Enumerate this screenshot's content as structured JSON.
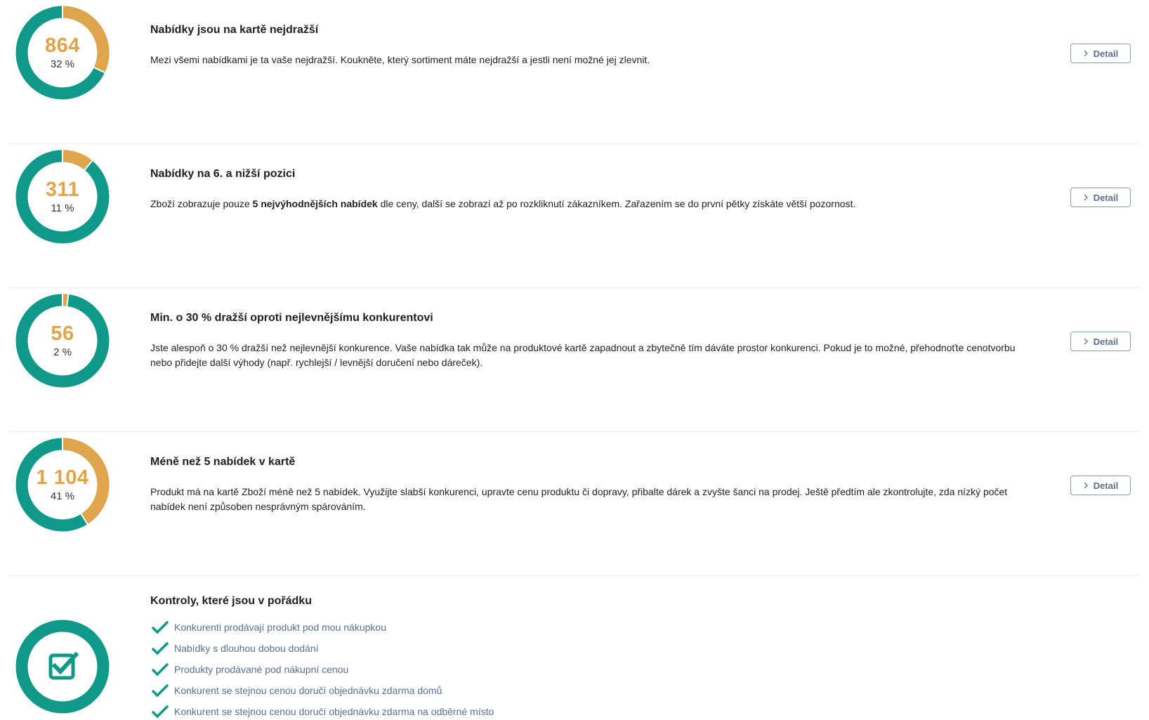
{
  "colors": {
    "teal": "#0f9988",
    "orange": "#e0a44a",
    "detail_border": "#8a9bb3",
    "detail_text": "#5b6f8f",
    "check_text": "#5b6f8f"
  },
  "rows": [
    {
      "value": "864",
      "percent": "32 %",
      "fraction": 0.32,
      "title": "Nabídky jsou na kartě nejdražší",
      "desc_before": "Mezi všemi nabídkami je ta vaše nejdražší. Koukněte, který sortiment máte nejdražší a jestli není možné jej zlevnit.",
      "desc_bold": "",
      "desc_after": "",
      "button": "Detail"
    },
    {
      "value": "311",
      "percent": "11 %",
      "fraction": 0.11,
      "title": "Nabídky na 6. a nižší pozici",
      "desc_before": "Zboží zobrazuje pouze ",
      "desc_bold": "5 nejvýhodnějších nabídek",
      "desc_after": " dle ceny, další se zobrazí až po rozkliknutí zákazníkem. Zařazením se do první pětky získáte větší pozornost.",
      "button": "Detail"
    },
    {
      "value": "56",
      "percent": "2 %",
      "fraction": 0.02,
      "title": "Min. o 30 % dražší oproti nejlevnějšímu konkurentovi",
      "desc_before": "Jste alespoň o 30 % dražší než nejlevnější konkurence. Vaše nabídka tak může na produktové kartě zapadnout a zbytečně tím dáváte prostor konkurenci. Pokud je to možné, přehodnoťte cenotvorbu nebo přidejte další výhody (např. rychlejší / levnější doručení nebo dáreček).",
      "desc_bold": "",
      "desc_after": "",
      "button": "Detail"
    },
    {
      "value": "1 104",
      "percent": "41 %",
      "fraction": 0.41,
      "title": "Méně než 5 nabídek v kartě",
      "desc_before": "Produkt má na kartě Zboží méně než 5 nabídek. Využijte slabší konkurenci, upravte cenu produktu či dopravy, přibalte dárek a zvyšte šanci na prodej. Ještě předtím ale zkontrolujte, zda nízký počet nabídek není způsoben nesprávným spárováním.",
      "desc_bold": "",
      "desc_after": "",
      "button": "Detail"
    }
  ],
  "ok_section": {
    "title": "Kontroly, které jsou v pořádku",
    "icon": "checkbox-checked-icon",
    "items": [
      "Konkurenti prodávají produkt pod mou nákupkou",
      "Nabídky s dlouhou dobou dodání",
      "Produkty prodávané pod nákupní cenou",
      "Konkurent se stejnou cenou doručí objednávku zdarma domů",
      "Konkurent se stejnou cenou doručí objednávku zdarma na odběrné místo"
    ]
  }
}
